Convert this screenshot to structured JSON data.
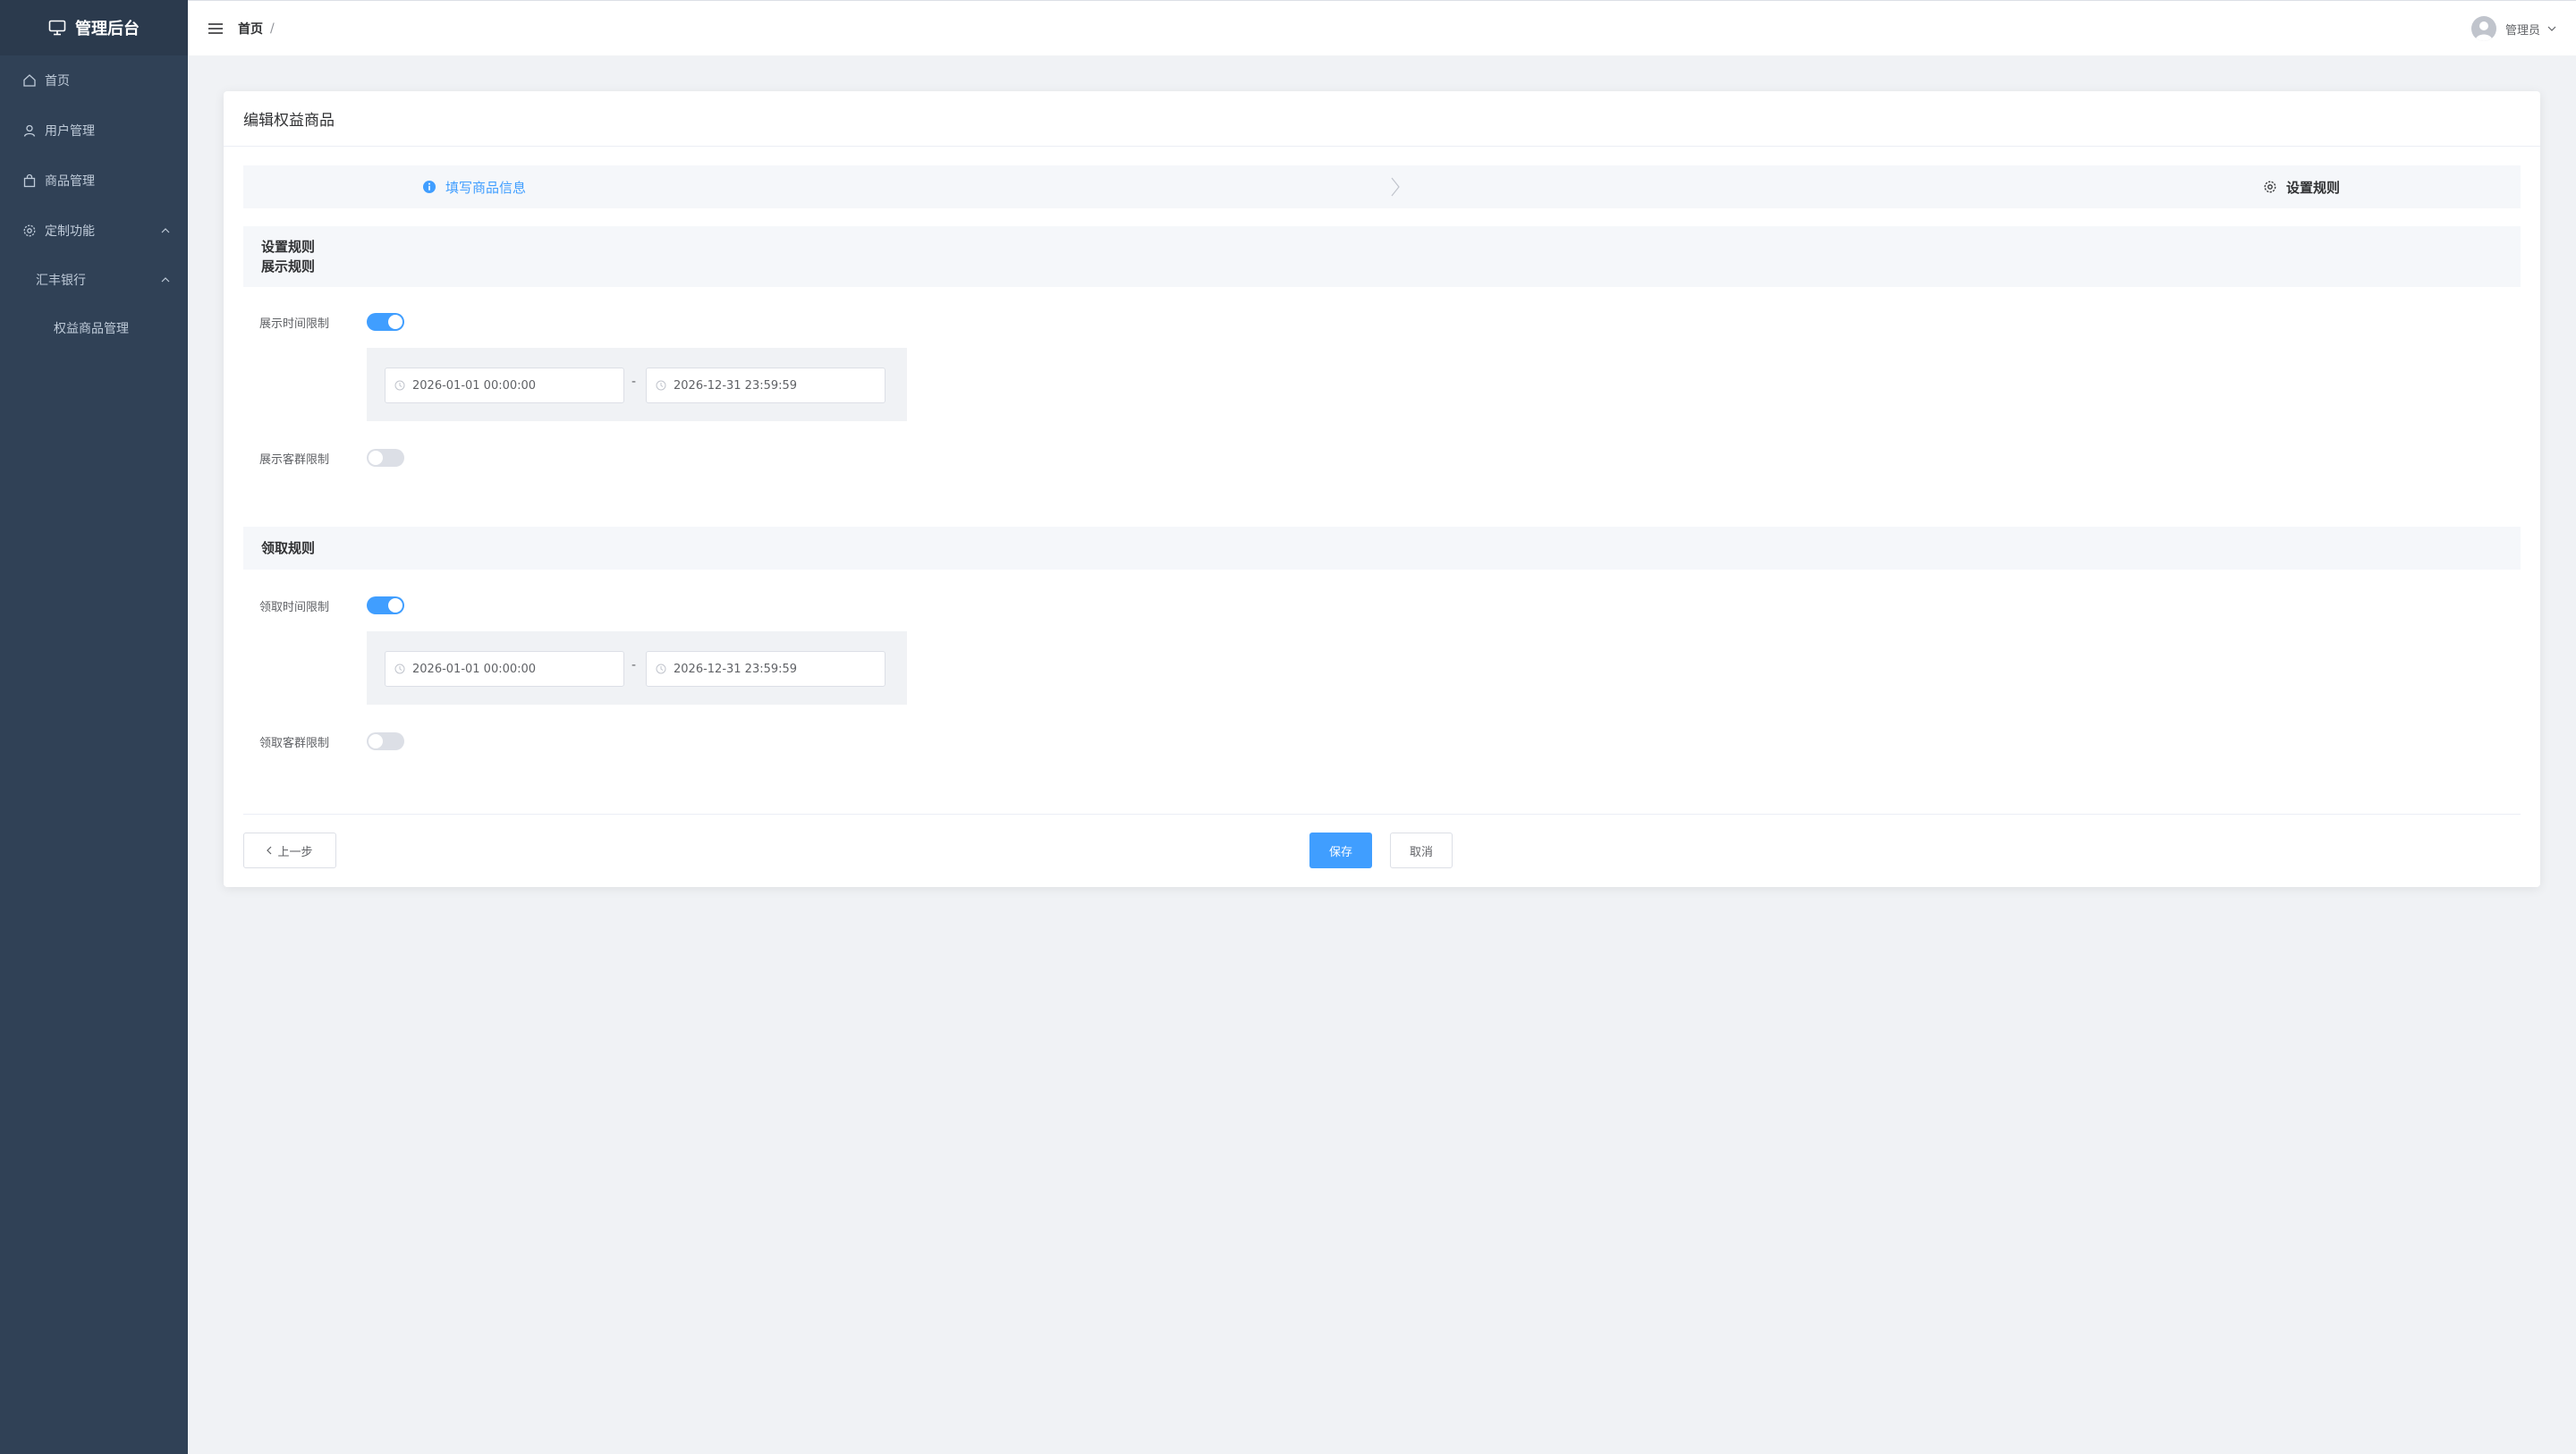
{
  "app": {
    "title": "管理后台"
  },
  "sidebar": {
    "items": [
      {
        "label": "首页",
        "icon": "home-icon"
      },
      {
        "label": "用户管理",
        "icon": "user-icon"
      },
      {
        "label": "商品管理",
        "icon": "shopping-bag-icon"
      },
      {
        "label": "定制功能",
        "icon": "gear-icon",
        "expanded": true
      },
      {
        "label": "汇丰银行",
        "expanded": true
      },
      {
        "label": "权益商品管理"
      }
    ]
  },
  "header": {
    "breadcrumb": [
      "首页",
      "/"
    ],
    "user": "管理员"
  },
  "card": {
    "title": "编辑权益商品",
    "steps": [
      {
        "label": "填写商品信息",
        "icon": "info-circle-icon",
        "state": "done"
      },
      {
        "label": "设置规则",
        "icon": "gear-icon",
        "state": "active"
      }
    ],
    "display_section": {
      "title": "设置规则",
      "subtitle": "展示规则"
    },
    "display_time": {
      "label": "展示时间限制",
      "on": true,
      "start": "2026-01-01 00:00:00",
      "end": "2026-12-31 23:59:59",
      "dash": "-"
    },
    "display_group": {
      "label": "展示客群限制",
      "on": false
    },
    "claim_section": {
      "title": "领取规则"
    },
    "claim_time": {
      "label": "领取时间限制",
      "on": true,
      "start": "2026-01-01 00:00:00",
      "end": "2026-12-31 23:59:59",
      "dash": "-"
    },
    "claim_group": {
      "label": "领取客群限制",
      "on": false
    },
    "buttons": {
      "prev": "上一步",
      "save": "保存",
      "cancel": "取消"
    }
  },
  "colors": {
    "sidebar_bg": "#304156",
    "primary": "#409eff",
    "page_bg": "#f0f2f5"
  }
}
